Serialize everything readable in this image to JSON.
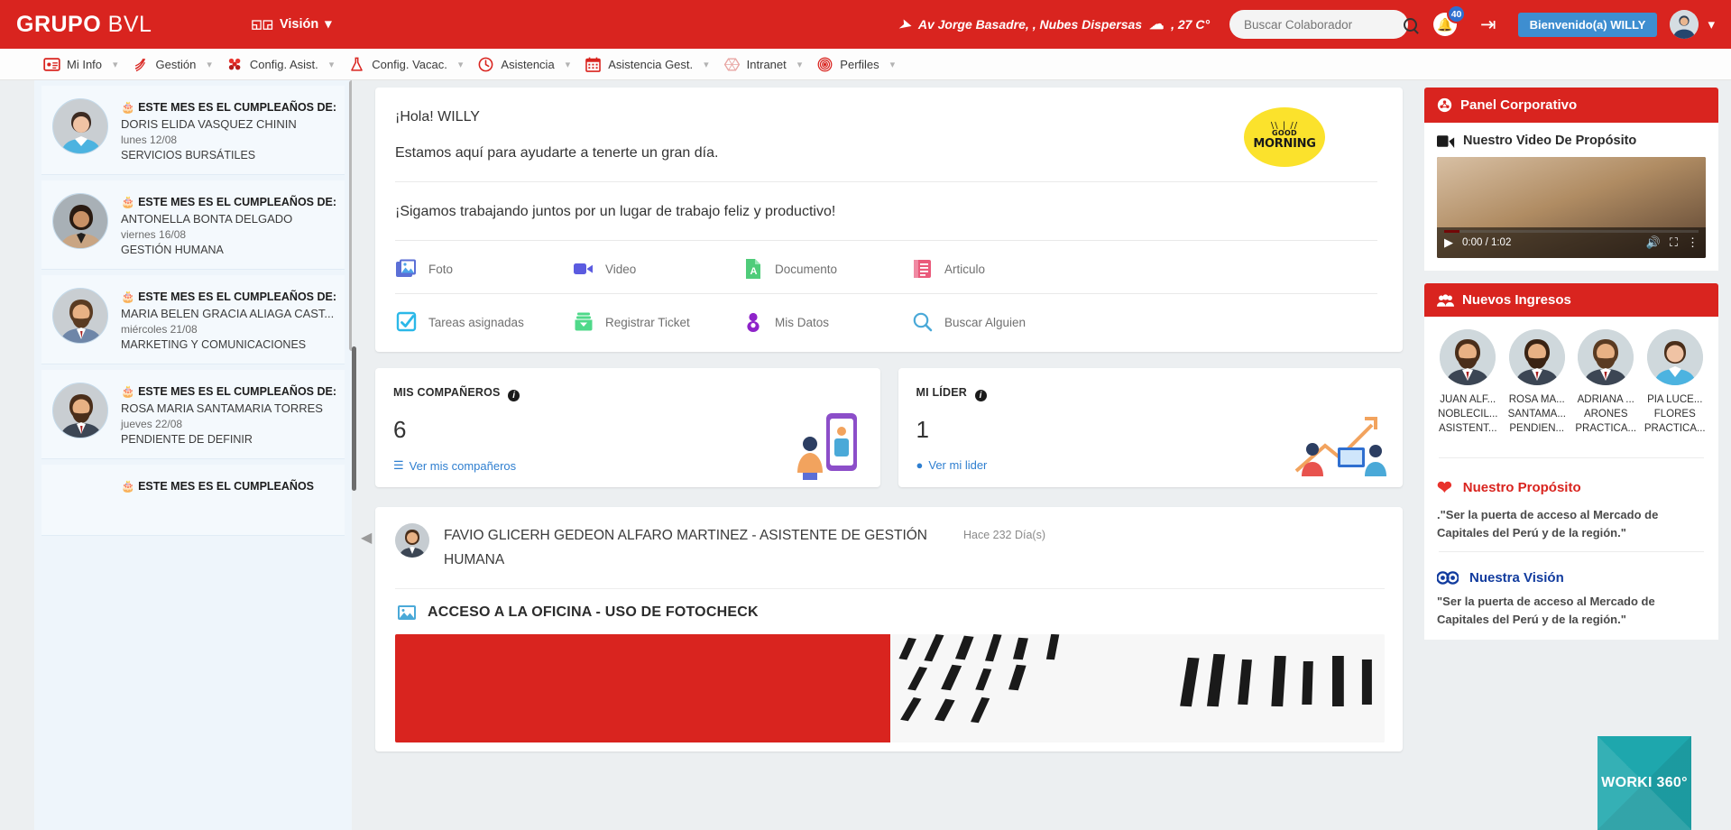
{
  "header": {
    "brand_bold": "GRUPO",
    "brand_light": "BVL",
    "vision_label": "Visión",
    "weather_location": "Av Jorge Basadre, , Nubes Dispersas",
    "weather_temp": ", 27 C°",
    "search_placeholder": "Buscar Colaborador",
    "notification_count": "40",
    "welcome_label": "Bienvenido(a) WILLY",
    "accent_red": "#d9241f",
    "badge_blue": "#2f6fd0",
    "welcome_blue": "#3e8ed0"
  },
  "nav": {
    "items": [
      {
        "label": "Mi Info",
        "icon": "id-card-icon"
      },
      {
        "label": "Gestión",
        "icon": "gestion-icon"
      },
      {
        "label": "Config. Asist.",
        "icon": "config-asist-icon"
      },
      {
        "label": "Config. Vacac.",
        "icon": "flask-icon"
      },
      {
        "label": "Asistencia",
        "icon": "clock-icon"
      },
      {
        "label": "Asistencia Gest.",
        "icon": "calendar-icon"
      },
      {
        "label": "Intranet",
        "icon": "hexagon-icon"
      },
      {
        "label": "Perfiles",
        "icon": "fingerprint-icon"
      }
    ]
  },
  "sidebar": {
    "birthdays": [
      {
        "headline": "ESTE MES ES EL CUMPLEAÑOS DE:",
        "name": "DORIS ELIDA VASQUEZ CHININ",
        "date": "lunes 12/08",
        "area": "SERVICIOS BURSÁTILES"
      },
      {
        "headline": "ESTE MES ES EL CUMPLEAÑOS DE:",
        "name": "ANTONELLA BONTA DELGADO",
        "date": "viernes 16/08",
        "area": "GESTIÓN HUMANA"
      },
      {
        "headline": "ESTE MES ES EL CUMPLEAÑOS DE:",
        "name": "MARIA BELEN GRACIA ALIAGA CAST...",
        "date": "miércoles 21/08",
        "area": "MARKETING Y COMUNICACIONES"
      },
      {
        "headline": "ESTE MES ES EL CUMPLEAÑOS DE:",
        "name": "ROSA MARIA SANTAMARIA TORRES",
        "date": "jueves 22/08",
        "area": "PENDIENTE DE DEFINIR"
      },
      {
        "headline": "ESTE MES ES EL CUMPLEAÑOS",
        "name": "",
        "date": "",
        "area": ""
      }
    ]
  },
  "main": {
    "greeting": "¡Hola! WILLY",
    "greeting_sub": "Estamos aquí para ayudarte a tenerte un gran día.",
    "motivation": "¡Sigamos trabajando juntos por un lugar de trabajo feliz y productivo!",
    "good_morning_rays": "\\\\ | //",
    "good_morning_small": "GOOD",
    "good_morning_big": "MORNING",
    "actions_row1": [
      {
        "label": "Foto",
        "icon": "photo-icon"
      },
      {
        "label": "Video",
        "icon": "video-icon"
      },
      {
        "label": "Documento",
        "icon": "pdf-document-icon"
      },
      {
        "label": "Articulo",
        "icon": "article-icon"
      }
    ],
    "actions_row2": [
      {
        "label": "Tareas asignadas",
        "icon": "checkbox-task-icon"
      },
      {
        "label": "Registrar Ticket",
        "icon": "inbox-ticket-icon"
      },
      {
        "label": "Mis Datos",
        "icon": "person-data-icon"
      },
      {
        "label": "Buscar Alguien",
        "icon": "search-person-icon"
      }
    ],
    "stats": [
      {
        "title": "MIS COMPAÑEROS",
        "value": "6",
        "link": "Ver mis compañeros",
        "link_icon": "list-icon"
      },
      {
        "title": "MI LÍDER",
        "value": "1",
        "link": "Ver mi lider",
        "link_icon": "person-icon"
      }
    ],
    "post": {
      "author": "FAVIO GLICERH GEDEON ALFARO MARTINEZ - ASISTENTE DE GESTIÓN HUMANA",
      "time": "Hace 232 Día(s)",
      "subject": "ACCESO A LA OFICINA - USO DE FOTOCHECK",
      "subject_icon": "image-icon"
    }
  },
  "right_panel": {
    "title": "Panel Corporativo",
    "title_icon": "corporate-icon",
    "video_section_title": "Nuestro Video De Propósito",
    "video_section_icon": "video-camera-icon",
    "video_time": "0:00 / 1:02",
    "new_entries_title": "Nuevos Ingresos",
    "new_entries_icon": "people-icon",
    "new_entries": [
      {
        "line1": "JUAN ALF...",
        "line2": "NOBLECIL...",
        "line3": "ASISTENT..."
      },
      {
        "line1": "ROSA MA...",
        "line2": "SANTAMA...",
        "line3": "PENDIEN..."
      },
      {
        "line1": "ADRIANA ...",
        "line2": "ARONES",
        "line3": "PRACTICA..."
      },
      {
        "line1": "PIA LUCE...",
        "line2": "FLORES",
        "line3": "PRACTICA..."
      }
    ],
    "purpose_title": "Nuestro Propósito",
    "purpose_icon": "heart-icon",
    "purpose_text": ".\"Ser la puerta de acceso al Mercado de Capitales del Perú y de la región.\"",
    "vision_title": "Nuestra Visión",
    "vision_icon": "binoculars-icon",
    "vision_text": "\"Ser la puerta de acceso al Mercado de Capitales del Perú y de la región.\"",
    "worki_label": "WORKI 360°",
    "worki_color": "#1ea7ad"
  }
}
